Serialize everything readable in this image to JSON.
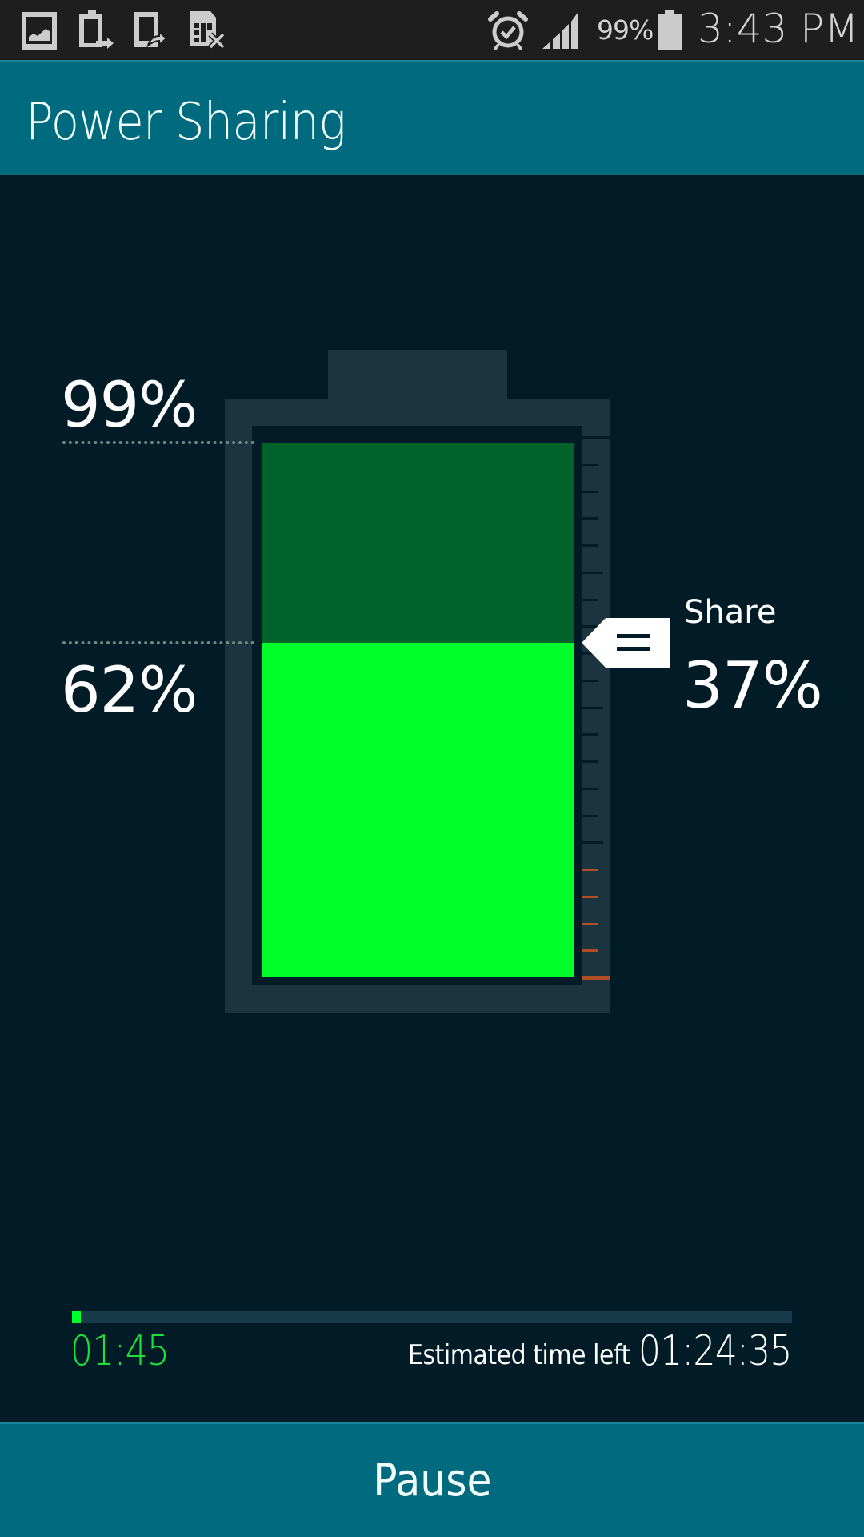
{
  "status_bar": {
    "left_icons": [
      "gallery-icon",
      "battery-transfer-icon",
      "phone-share-icon",
      "sim-card-error-icon"
    ],
    "right_icons": [
      "alarm-icon",
      "signal-icon",
      "battery-icon"
    ],
    "battery_percent": "99%",
    "time": "3:43 PM"
  },
  "header": {
    "title": "Power Sharing"
  },
  "battery": {
    "start_label": "99%",
    "target_label": "62%",
    "start_level": 0.99,
    "target_level": 0.62,
    "share_label": "Share",
    "share_value": "37%",
    "colors": {
      "remaining": "#00632a",
      "after_share": "#00ff2a",
      "warning_tick": "#b34d24"
    }
  },
  "progress": {
    "fraction": 0.012,
    "elapsed": "01:45",
    "estimated_label": "Estimated time left",
    "estimated_value": "01:24:35"
  },
  "actions": {
    "pause_label": "Pause"
  }
}
